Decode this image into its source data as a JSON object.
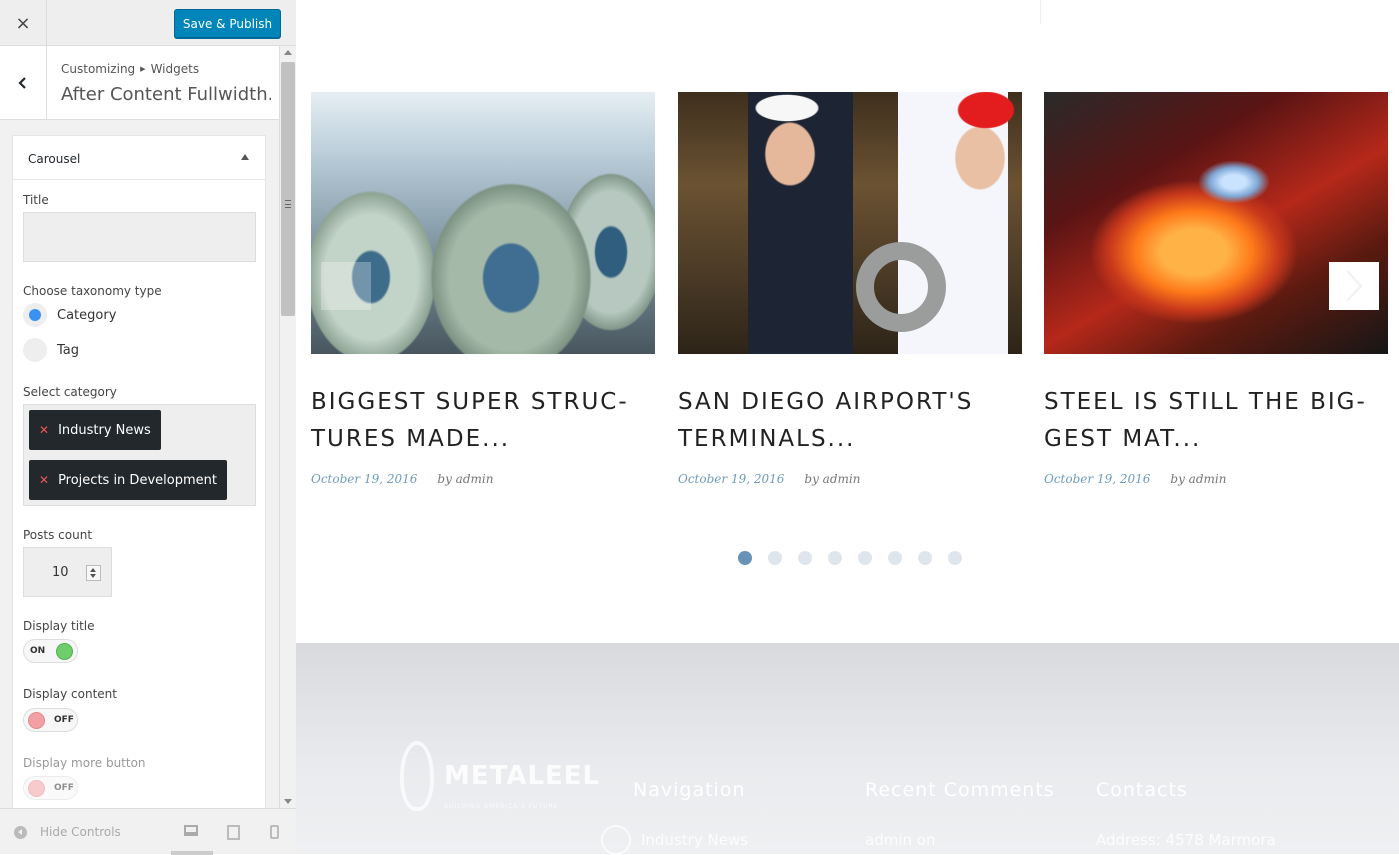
{
  "topbar": {
    "close_icon": "×",
    "publish_label": "Save & Publish"
  },
  "section": {
    "breadcrumb_root": "Customizing",
    "breadcrumb_child": "Widgets",
    "title": "After Content Fullwidth..."
  },
  "widget": {
    "title": "Carousel",
    "fields": {
      "title_label": "Title",
      "title_value": "",
      "taxonomy_label": "Choose taxonomy type",
      "taxonomy_options": [
        "Category",
        "Tag"
      ],
      "taxonomy_selected": "Category",
      "category_label": "Select category",
      "categories": [
        "Industry News",
        "Projects in Development"
      ],
      "posts_count_label": "Posts count",
      "posts_count": "10",
      "display_title_label": "Display title",
      "display_title_state": "ON",
      "display_content_label": "Display content",
      "display_content_state": "OFF",
      "display_more_label": "Display more button",
      "display_more_state": "OFF"
    }
  },
  "footer_controls": {
    "hide_label": "Hide Controls"
  },
  "preview": {
    "posts": [
      {
        "title": "BIGGEST SUPER STRUC-TURES MADE...",
        "date": "October 19, 2016",
        "author": "by admin"
      },
      {
        "title": "SAN DIEGO AIRPORT'S TERMINALS...",
        "date": "October 19, 2016",
        "author": "by admin"
      },
      {
        "title": "STEEL IS STILL THE BIG-GEST MAT...",
        "date": "October 19, 2016",
        "author": "by admin"
      }
    ],
    "pagination_dots": 8,
    "active_dot": 1,
    "footer": {
      "logo_text": "METALEEL",
      "logo_tagline": "BUILDING AMERICA'S FUTURE",
      "col_navigation": "Navigation",
      "col_comments": "Recent Comments",
      "col_contacts": "Contacts",
      "nav_item": "Industry News",
      "comment_item": "admin on",
      "contact_item": "Address: 4578 Marmora"
    }
  },
  "colors": {
    "publish_bg": "#0085ba",
    "radio_on": "#3b91f3",
    "toggle_on": "#6ccf6c",
    "toggle_off": "#f3a0a4",
    "date_color": "#6e9bbd",
    "dot_active": "#6693b7"
  }
}
